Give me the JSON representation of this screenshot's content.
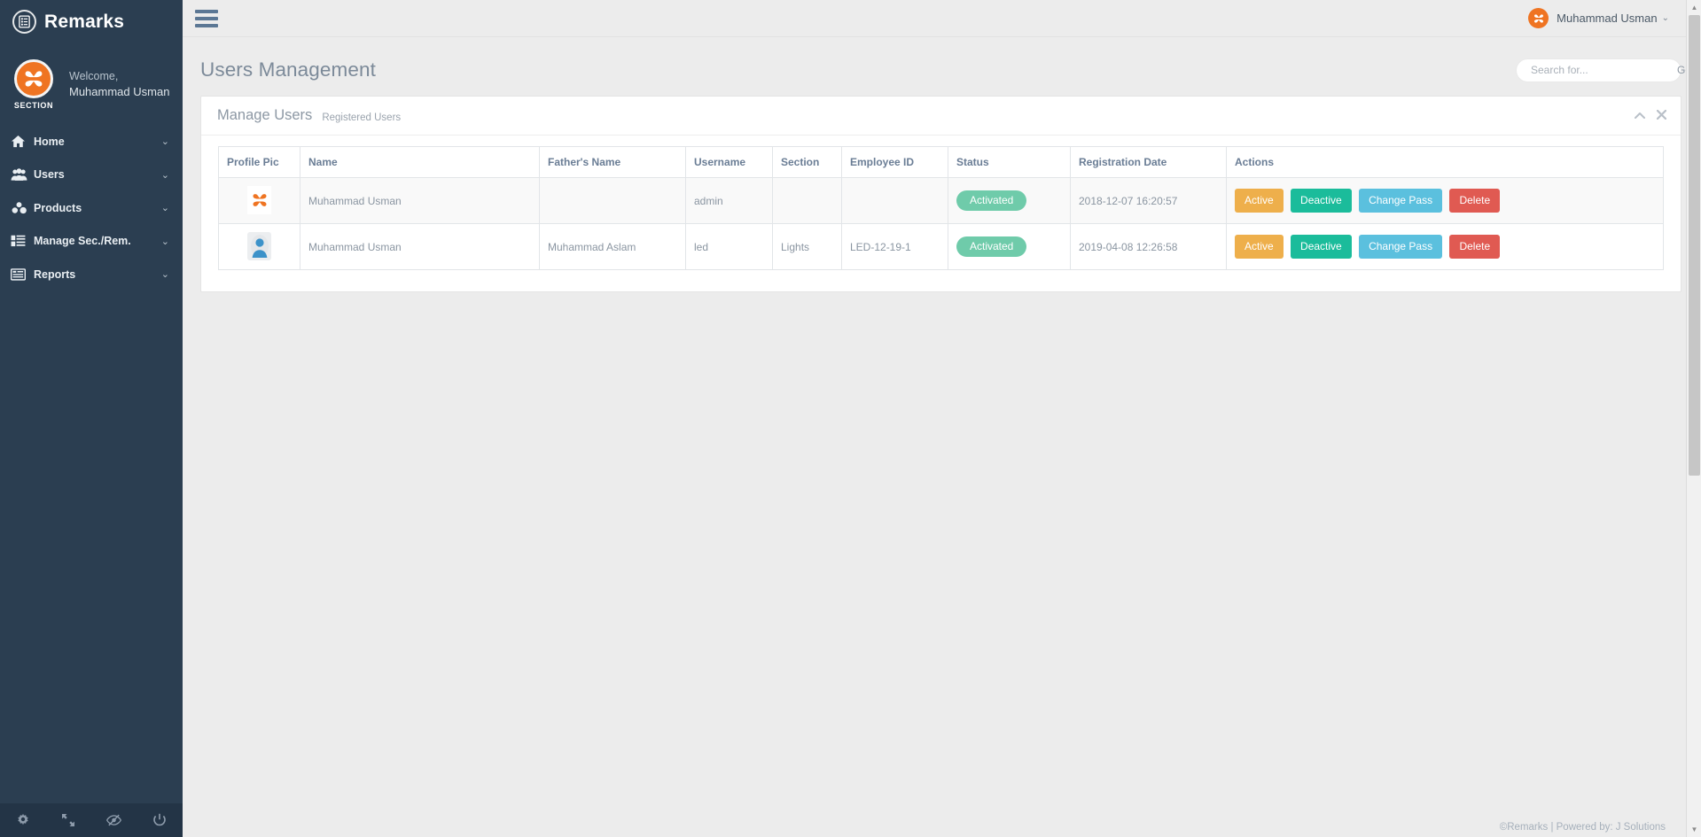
{
  "brand": {
    "name": "Remarks",
    "icon": "document-list-icon"
  },
  "sidebar": {
    "profile": {
      "greeting": "Welcome,",
      "name": "Muhammad Usman",
      "section_label": "SECTION",
      "avatar_icon": "company-logo-icon"
    },
    "items": [
      {
        "label": "Home",
        "icon": "home-icon",
        "caret": "⌄"
      },
      {
        "label": "Users",
        "icon": "users-group-icon",
        "caret": "⌄"
      },
      {
        "label": "Products",
        "icon": "cubes-icon",
        "caret": "⌄"
      },
      {
        "label": "Manage Sec./Rem.",
        "icon": "list-grid-icon",
        "caret": "⌄"
      },
      {
        "label": "Reports",
        "icon": "window-table-icon",
        "caret": "⌄"
      }
    ],
    "footer_buttons": [
      {
        "icon": "gear-icon",
        "title": "Settings"
      },
      {
        "icon": "expand-icon",
        "title": "Fullscreen"
      },
      {
        "icon": "eye-slash-icon",
        "title": "Lock Screen"
      },
      {
        "icon": "power-icon",
        "title": "Logout"
      }
    ]
  },
  "topbar": {
    "menu_icon": "hamburger-icon",
    "user_name": "Muhammad Usman",
    "user_caret": "⌄",
    "user_avatar_icon": "company-logo-icon"
  },
  "page": {
    "title": "Users Management"
  },
  "search": {
    "value": "",
    "placeholder": "Search for...",
    "button_label": "Go!"
  },
  "panel": {
    "title": "Manage Users",
    "subtitle": "Registered Users",
    "collapse_icon": "chevron-up-icon",
    "close_icon": "close-icon",
    "collapse_glyph": "▲",
    "close_glyph": "✖"
  },
  "table": {
    "columns": [
      "Profile Pic",
      "Name",
      "Father's Name",
      "Username",
      "Section",
      "Employee ID",
      "Status",
      "Registration Date",
      "Actions"
    ],
    "rows": [
      {
        "avatar_type": "logo",
        "avatar_icon": "company-logo-icon",
        "name": "Muhammad Usman",
        "fathers_name": "",
        "username": "admin",
        "section": "",
        "employee_id": "",
        "status": "Activated",
        "registration_date": "2018-12-07 16:20:57"
      },
      {
        "avatar_type": "person",
        "avatar_icon": "user-placeholder-icon",
        "name": "Muhammad Usman",
        "fathers_name": "Muhammad Aslam",
        "username": "led",
        "section": "Lights",
        "employee_id": "LED-12-19-1",
        "status": "Activated",
        "registration_date": "2019-04-08 12:26:58"
      }
    ],
    "actions": {
      "active": "Active",
      "deactive": "Deactive",
      "change_pass": "Change Pass",
      "delete": "Delete"
    }
  },
  "footer": {
    "text": "©Remarks | Powered by: J Solutions"
  },
  "colors": {
    "sidebar_bg": "#2b3e51",
    "accent_orange": "#ef7422",
    "badge_green": "#6fcbaa",
    "btn_active": "#eeaf4b",
    "btn_deactive": "#1bbc9b",
    "btn_pass": "#5bc0de",
    "btn_delete": "#e05a52"
  }
}
